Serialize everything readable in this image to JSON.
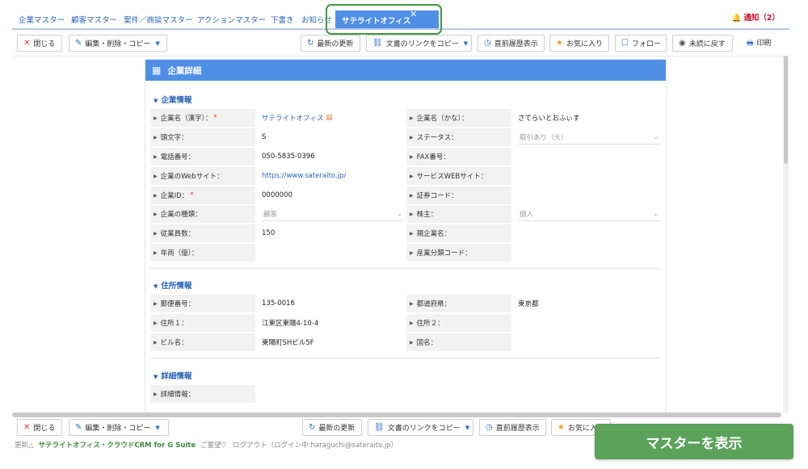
{
  "tabs": [
    {
      "label": "企業マスター"
    },
    {
      "label": "顧客マスター"
    },
    {
      "label": "案件／商談マスター"
    },
    {
      "label": "アクションマスター"
    },
    {
      "label": "下書き"
    },
    {
      "label": "お知らせ"
    },
    {
      "label": "サテライトオフィス",
      "active": true
    }
  ],
  "notice": {
    "label": "通知（2）"
  },
  "toolbar": {
    "close": "閉じる",
    "edit": "編集・削除・コピー",
    "refresh": "最新の更新",
    "copy_link": "文書のリンクをコピー",
    "history": "直前履歴表示",
    "favorite": "お気に入り",
    "follow": "フォロー",
    "unread": "未読に戻す",
    "print": "印刷"
  },
  "bottom_toolbar": {
    "close": "閉じる",
    "edit": "編集・削除・コピー",
    "refresh": "最新の更新",
    "copy_link": "文書のリンクをコピー",
    "history": "直前履歴表示",
    "favorite": "お気に入"
  },
  "panel": {
    "title": "企業詳細"
  },
  "sections": {
    "company": "企業情報",
    "address": "住所情報",
    "detail": "詳細情報"
  },
  "company_fields": {
    "name_kanji": {
      "label": "企業名（漢字）：",
      "value": "サテライトオフィス"
    },
    "name_kana": {
      "label": "企業名（かな）：",
      "value": "さてらいとおふぃす"
    },
    "initial": {
      "label": "頭文字：",
      "value": "S"
    },
    "status": {
      "label": "ステータス：",
      "value": "取引あり（大）"
    },
    "phone": {
      "label": "電話番号：",
      "value": "050-5835-0396"
    },
    "fax": {
      "label": "FAX番号：",
      "value": ""
    },
    "website": {
      "label": "企業のWebサイト：",
      "value": "https://www.sateraito.jp/"
    },
    "service_web": {
      "label": "サービスWEBサイト：",
      "value": ""
    },
    "company_id": {
      "label": "企業ID：",
      "value": "0000000"
    },
    "securities_code": {
      "label": "証券コード：",
      "value": ""
    },
    "company_type": {
      "label": "企業の種類：",
      "value": "顧客"
    },
    "shareholder": {
      "label": "株主：",
      "value": "個人"
    },
    "employees": {
      "label": "従業員数：",
      "value": "150"
    },
    "parent": {
      "label": "親企業名：",
      "value": ""
    },
    "revenue": {
      "label": "年商（億）：",
      "value": ""
    },
    "industry_code": {
      "label": "産業分類コード：",
      "value": ""
    }
  },
  "address_fields": {
    "postal": {
      "label": "郵便番号：",
      "value": "135-0016"
    },
    "prefecture": {
      "label": "都道府県：",
      "value": "東京都"
    },
    "address1": {
      "label": "住所１：",
      "value": "江東区東陽4-10-4"
    },
    "address2": {
      "label": "住所２：",
      "value": ""
    },
    "building": {
      "label": "ビル名：",
      "value": "東陽町SHビル5F"
    },
    "country": {
      "label": "国名：",
      "value": ""
    }
  },
  "detail_fields": {
    "detail": {
      "label": "詳細情報：",
      "value": ""
    }
  },
  "footer": {
    "update": "更新△",
    "brand": "サテライトオフィス・クラウドCRM for G Suite",
    "request": "ご要望▽",
    "logout": "ログアウト（ログイン中:haraguchi@sateraito.jp）"
  },
  "master_button": {
    "label": "マスターを表示"
  },
  "colors": {
    "accent": "#4f8fe6",
    "link": "#2a63b8",
    "green": "#5ba25b",
    "required": "#e0382e"
  }
}
